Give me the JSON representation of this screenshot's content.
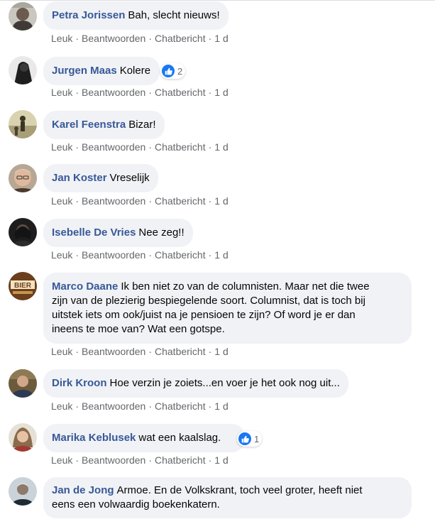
{
  "actions": {
    "like": "Leuk",
    "reply": "Beantwoorden",
    "chat": "Chatbericht",
    "separator": "·"
  },
  "comments": [
    {
      "author": "Petra Jorissen",
      "text": "Bah, slecht nieuws!",
      "time": "1 d"
    },
    {
      "author": "Jurgen Maas",
      "text": "Kolere",
      "time": "1 d",
      "reaction_icon": "like-icon",
      "reaction_count": "2"
    },
    {
      "author": "Karel Feenstra",
      "text": "Bizar!",
      "time": "1 d"
    },
    {
      "author": "Jan Koster",
      "text": "Vreselijk",
      "time": "1 d"
    },
    {
      "author": "Isebelle De Vries",
      "text": "Nee zeg!!",
      "time": "1 d"
    },
    {
      "author": "Marco Daane",
      "text_lines": [
        "Ik ben niet zo van de columnisten. Maar net die twee",
        "zijn van de plezierig bespiegelende soort. Columnist, dat is toch bij",
        "uitstek iets om ook/juist na je pensioen te zijn? Of word je er dan",
        "ineens te moe van? Wat een gotspe."
      ],
      "time": "1 d",
      "avatar_text": "BIER"
    },
    {
      "author": "Dirk Kroon",
      "text": "Hoe verzin je zoiets...en voer je het ook nog uit...",
      "time": "1 d"
    },
    {
      "author": "Marika Keblusek",
      "text": "wat een kaalslag.",
      "time": "1 d",
      "reaction_icon": "like-icon",
      "reaction_count": "1"
    },
    {
      "author": "Jan de Jong",
      "text_lines": [
        "Armoe. En de Volkskrant, toch veel groter, heeft niet",
        "eens een volwaardig boekenkatern."
      ]
    }
  ],
  "colors": {
    "author": "#385898",
    "bubble": "#f0f2f5",
    "meta": "#65676b",
    "like": "#1877f2"
  }
}
